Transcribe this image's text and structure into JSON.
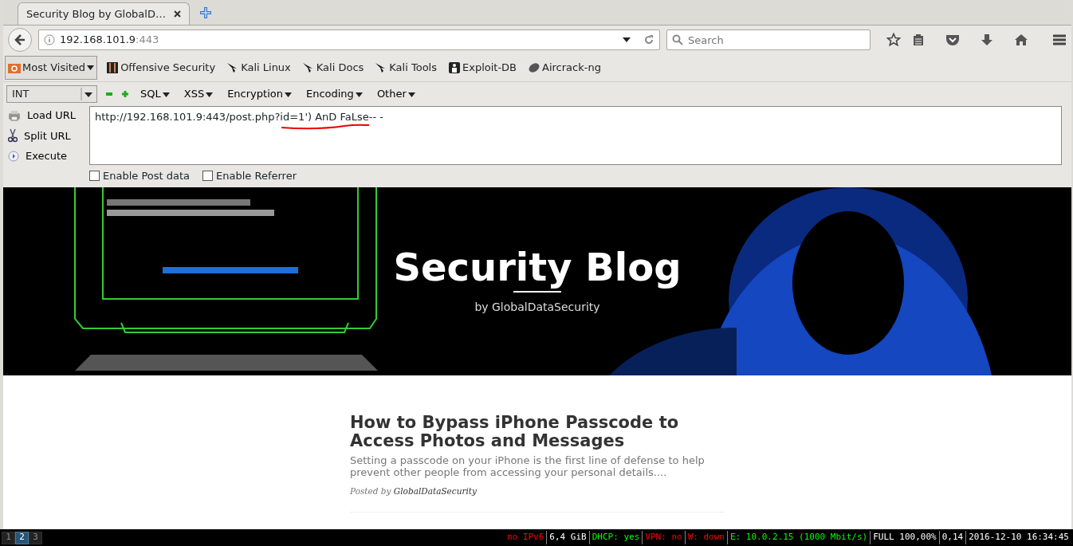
{
  "tabs": [
    {
      "title": "Security Blog by GlobalD…",
      "selected": true
    }
  ],
  "address": {
    "host": "192.168.101.9",
    "port": ":443"
  },
  "search": {
    "placeholder": "Search"
  },
  "bookmarks": [
    {
      "label": "Most Visited",
      "kind": "menu"
    },
    {
      "label": "Offensive Security",
      "kind": "link"
    },
    {
      "label": "Kali Linux",
      "kind": "link"
    },
    {
      "label": "Kali Docs",
      "kind": "link"
    },
    {
      "label": "Kali Tools",
      "kind": "link"
    },
    {
      "label": "Exploit-DB",
      "kind": "link"
    },
    {
      "label": "Aircrack-ng",
      "kind": "link"
    }
  ],
  "hackbar": {
    "type_select": "INT",
    "menus": [
      "SQL",
      "XSS",
      "Encryption",
      "Encoding",
      "Other"
    ],
    "actions": [
      {
        "label": "Load URL",
        "kind": "load"
      },
      {
        "label": "Split URL",
        "kind": "split"
      },
      {
        "label": "Execute",
        "kind": "execute"
      }
    ],
    "url": "http://192.168.101.9:443/post.php?id=1') AnD FaLse-- -",
    "options": [
      {
        "label": "Enable Post data",
        "checked": false
      },
      {
        "label": "Enable Referrer",
        "checked": false
      }
    ]
  },
  "hero": {
    "title": "Security Blog",
    "subtitle": "by GlobalDataSecurity"
  },
  "post": {
    "title": "How to Bypass iPhone Passcode to Access Photos and Messages",
    "excerpt": "Setting a passcode on your iPhone is the first line of defense to help prevent other people from accessing your personal details....",
    "meta_prefix": "Posted by",
    "author": "GlobalDataSecurity"
  },
  "status_bar": {
    "workspaces": [
      {
        "label": "1",
        "selected": false
      },
      {
        "label": "2",
        "selected": true
      },
      {
        "label": "3",
        "selected": false
      }
    ],
    "items": [
      {
        "text": "no IPv6",
        "color": "#ff0000"
      },
      {
        "text": "6,4 GiB",
        "color": "#ffffff"
      },
      {
        "text": "DHCP: yes",
        "color": "#00ff00"
      },
      {
        "text": "VPN: no",
        "color": "#ff0000"
      },
      {
        "text": "W: down",
        "color": "#ff0000"
      },
      {
        "text": "E: 10.0.2.15 (1000 Mbit/s)",
        "color": "#00ff00"
      },
      {
        "text": "FULL 100,00%",
        "color": "#ffffff"
      },
      {
        "text": "0,14",
        "color": "#ffffff"
      },
      {
        "text": "2016-12-10 16:34:45",
        "color": "#ffffff"
      }
    ]
  }
}
